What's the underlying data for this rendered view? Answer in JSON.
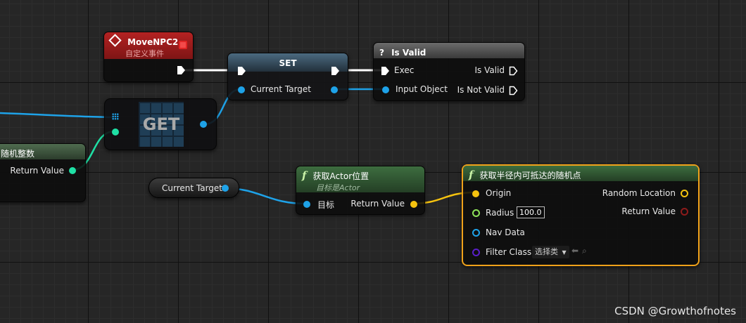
{
  "nodes": {
    "event": {
      "title": "MoveNPC2",
      "subtitle": "自定义事件",
      "header_color": "#9d1b1b"
    },
    "set": {
      "title": "SET",
      "pin_label": "Current Target"
    },
    "is_valid": {
      "icon": "?",
      "title": "Is Valid",
      "inputs": [
        "Exec",
        "Input Object"
      ],
      "outputs": [
        "Is Valid",
        "Is Not Valid"
      ]
    },
    "get": {
      "title": "GET"
    },
    "random_int": {
      "title": "随机整数",
      "output": "Return Value"
    },
    "current_target_var": {
      "label": "Current Target"
    },
    "get_actor_location": {
      "title": "获取Actor位置",
      "subtitle": "目标是Actor",
      "input": "目标",
      "output": "Return Value"
    },
    "get_random_reachable": {
      "title": "获取半径内可抵达的随机点",
      "inputs": [
        "Origin",
        "Radius",
        "Nav Data",
        "Filter Class"
      ],
      "radius_value": "100.0",
      "filter_select": "选择类",
      "outputs": [
        "Random Location",
        "Return Value"
      ]
    }
  },
  "colors": {
    "exec": "#ffffff",
    "object": "#1ea2e8",
    "integer": "#1fe0a5",
    "vector": "#f6c30f",
    "float": "#8ee35a",
    "bool": "#8d1b1b",
    "class": "#5a1fc9",
    "selected_border": "#f0a21a"
  },
  "watermark": "CSDN @Growthofnotes"
}
